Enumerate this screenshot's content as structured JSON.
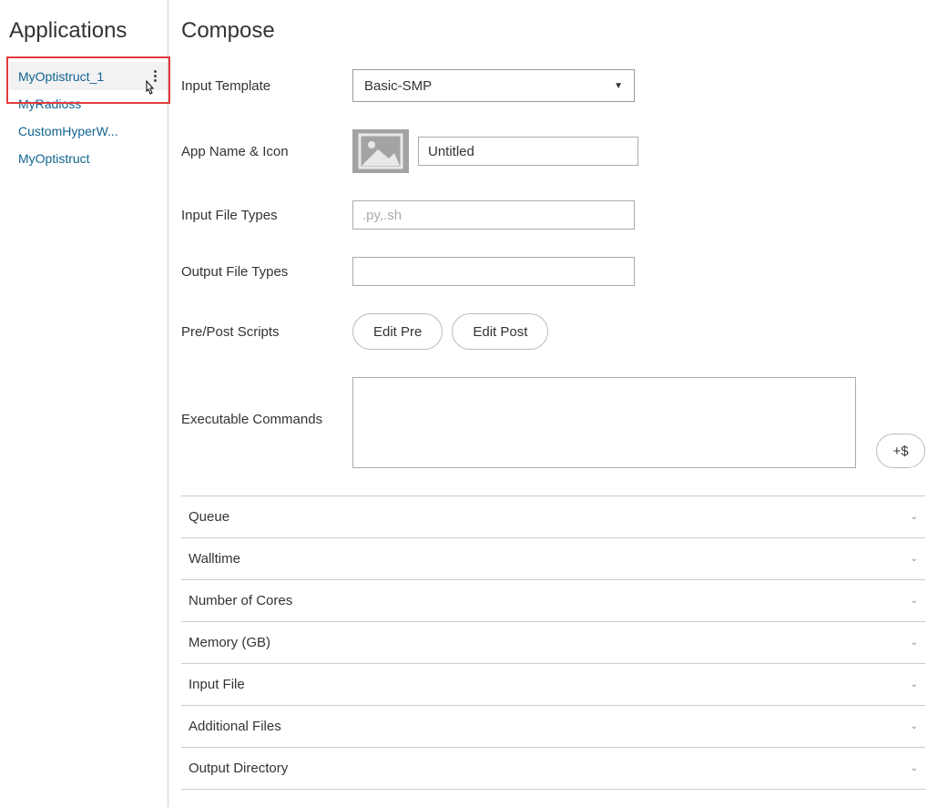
{
  "sidebar": {
    "title": "Applications",
    "items": [
      {
        "label": "MyOptistruct_1",
        "selected": true
      },
      {
        "label": "MyRadioss",
        "selected": false
      },
      {
        "label": "CustomHyperW...",
        "selected": false
      },
      {
        "label": "MyOptistruct",
        "selected": false
      }
    ]
  },
  "main": {
    "title": "Compose",
    "form": {
      "input_template": {
        "label": "Input Template",
        "value": "Basic-SMP"
      },
      "app_name_icon": {
        "label": "App Name & Icon",
        "value": "Untitled"
      },
      "input_file_types": {
        "label": "Input File Types",
        "value": "",
        "placeholder": ".py,.sh"
      },
      "output_file_types": {
        "label": "Output File Types",
        "value": ""
      },
      "pre_post_scripts": {
        "label": "Pre/Post Scripts",
        "edit_pre": "Edit Pre",
        "edit_post": "Edit Post"
      },
      "executable_commands": {
        "label": "Executable Commands",
        "value": "",
        "add_var": "+$"
      }
    },
    "accordion": [
      {
        "label": "Queue"
      },
      {
        "label": "Walltime"
      },
      {
        "label": "Number of Cores"
      },
      {
        "label": "Memory (GB)"
      },
      {
        "label": "Input File"
      },
      {
        "label": "Additional Files"
      },
      {
        "label": "Output Directory"
      }
    ]
  }
}
